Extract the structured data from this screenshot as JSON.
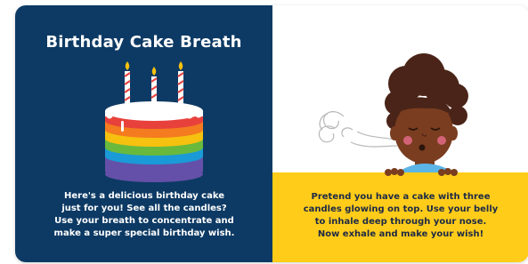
{
  "left_page": {
    "title": "Birthday Cake Breath",
    "text": "Here's a delicious birthday cake\njust for you! See all the candles?\nUse your breath to concentrate and\nmake a super special birthday wish.",
    "cake_stripe_colors": [
      "#e8413c",
      "#f47b20",
      "#f6c10f",
      "#69b93d",
      "#1a9ad6",
      "#6450a8"
    ]
  },
  "right_page": {
    "text": "Pretend you have a cake with three\ncandles glowing on top. Use your belly\nto inhale deep through your nose.\nNow exhale and make your wish!",
    "band_color": "#ffcc1a"
  }
}
